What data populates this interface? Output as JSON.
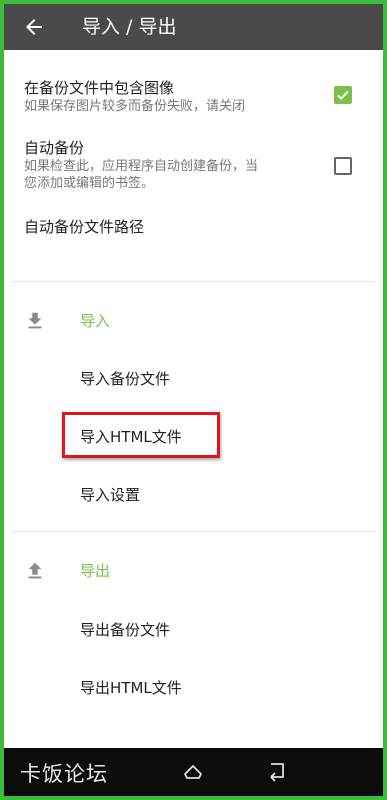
{
  "header": {
    "title": "导入 / 导出"
  },
  "settings": {
    "include_images": {
      "title": "在备份文件中包含图像",
      "summary": "如果保存图片较多而备份失败，请关闭",
      "checked": true
    },
    "auto_backup": {
      "title": "自动备份",
      "summary_line1": "如果检查此，应用程序自动创建备份，当",
      "summary_line2": "您添加或编辑的书签。",
      "checked": false
    },
    "auto_backup_path": {
      "title": "自动备份文件路径"
    }
  },
  "import": {
    "label": "导入",
    "icon": "download-icon",
    "items": [
      "导入备份文件",
      "导入HTML文件",
      "导入设置"
    ]
  },
  "export": {
    "label": "导出",
    "icon": "upload-icon",
    "items": [
      "导出备份文件",
      "导出HTML文件"
    ]
  },
  "navbar": {
    "watermark": "卡饭论坛"
  },
  "colors": {
    "toolbar": "#4a4a4a",
    "accent": "#7cc04a",
    "highlight_box": "#e0141a",
    "outer_border": "#3dbb3d"
  }
}
